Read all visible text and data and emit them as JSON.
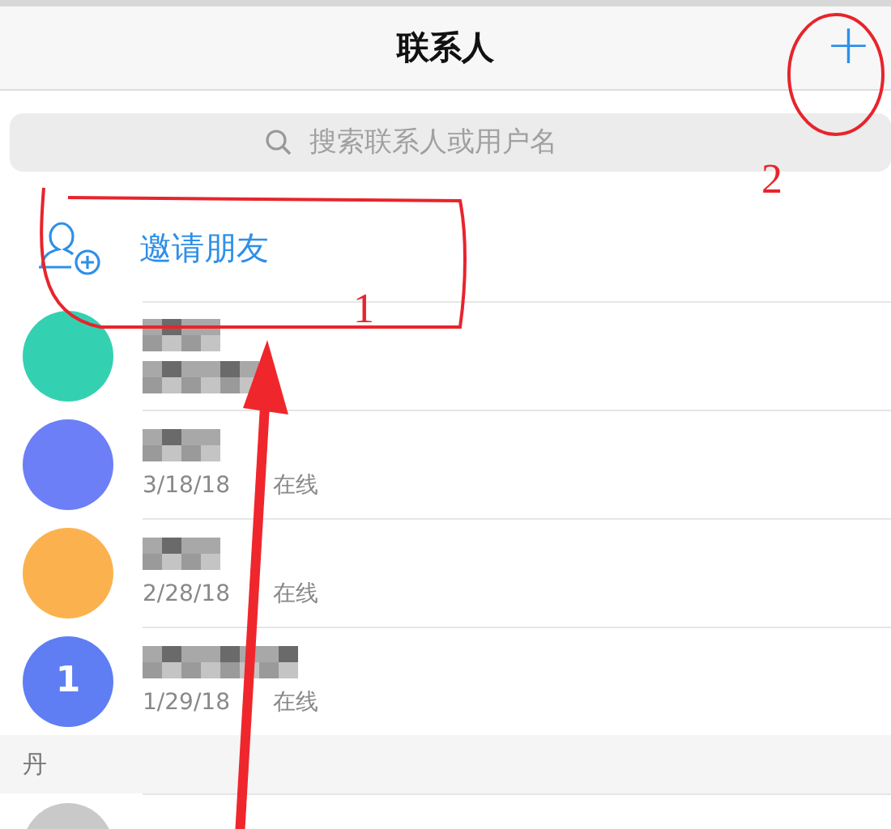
{
  "header": {
    "title": "联系人",
    "add_button": "+"
  },
  "search": {
    "placeholder": "搜索联系人或用户名"
  },
  "invite": {
    "label": "邀请朋友"
  },
  "contacts": [
    {
      "color": "#33d1b2"
    },
    {
      "color": "#6d7ff6",
      "status": "3/18/18 在线"
    },
    {
      "color": "#fbb24e",
      "status": "2/28/18 在线"
    },
    {
      "color": "#5f7ef4",
      "avatar_text": "1",
      "status": "1/29/18 在线"
    }
  ],
  "section": {
    "letter": "丹"
  },
  "more_contacts": [
    {
      "color": "#c9c9c9"
    }
  ],
  "annotations": [
    {
      "label": "1"
    },
    {
      "label": "2"
    }
  ]
}
